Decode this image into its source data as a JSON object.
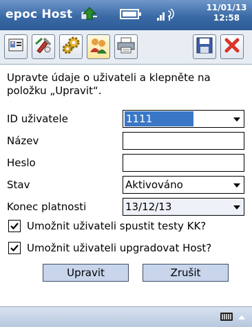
{
  "titlebar": {
    "app_title": "epoc Host",
    "date": "11/01/13",
    "time": "12:58",
    "icons": [
      "sync-icon",
      "battery-icon",
      "signal-icon"
    ]
  },
  "toolbar": {
    "tools": [
      {
        "name": "patient-icon",
        "active": false
      },
      {
        "name": "tools-icon",
        "active": false
      },
      {
        "name": "settings-gears-icon",
        "active": false
      },
      {
        "name": "users-icon",
        "active": true
      },
      {
        "name": "printer-icon",
        "active": false
      },
      {
        "name": "save-icon",
        "active": false
      },
      {
        "name": "close-icon",
        "active": false
      }
    ]
  },
  "form": {
    "instructions": "Upravte údaje o uživateli a klepněte na položku „Upravit“.",
    "user_id_label": "ID uživatele",
    "user_id_value": "1111",
    "name_label": "Název",
    "name_value": "",
    "password_label": "Heslo",
    "password_value": "",
    "status_label": "Stav",
    "status_value": "Aktivováno",
    "expiry_label": "Konec platnosti",
    "expiry_value": "13/12/13",
    "allow_qc_label": "Umožnit uživateli spustit testy KK?",
    "allow_qc_checked": true,
    "allow_upgrade_label": "Umožnit uživateli upgradovat Host?",
    "allow_upgrade_checked": true,
    "edit_button": "Upravit",
    "cancel_button": "Zrušit"
  },
  "colors": {
    "titlebar": "#3a6aa6",
    "selection": "#3a78c7",
    "button": "#c8d5eb"
  }
}
